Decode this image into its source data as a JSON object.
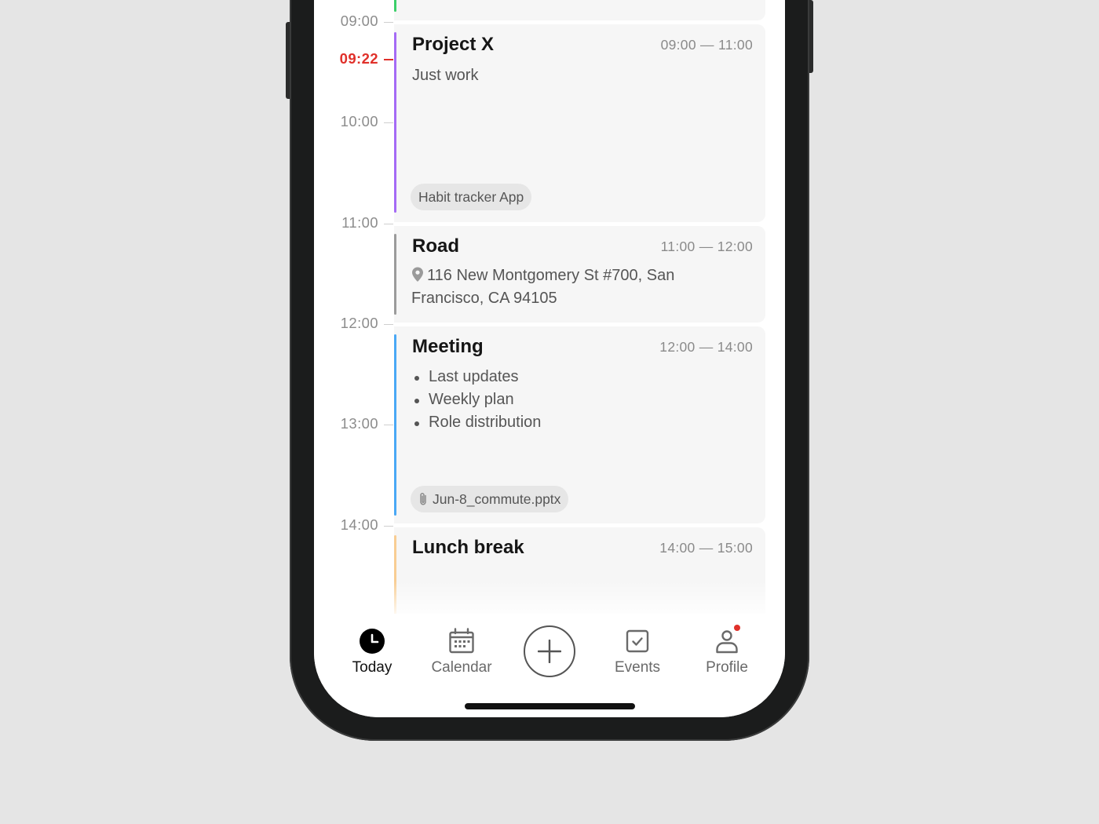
{
  "timeline": {
    "labels": [
      "09:00",
      "10:00",
      "11:00",
      "12:00",
      "13:00",
      "14:00"
    ],
    "current_time": "09:22"
  },
  "events": [
    {
      "title": "Project X",
      "time_range": "09:00 — 11:00",
      "description": "Just work",
      "tag": "Habit tracker App",
      "accent_color": "#a56bf5"
    },
    {
      "title": "Road",
      "time_range": "11:00 — 12:00",
      "address": "116 New Montgomery St #700, San Francisco, CA 94105",
      "accent_color": "#9b9b9b"
    },
    {
      "title": "Meeting",
      "time_range": "12:00 — 14:00",
      "agenda": [
        "Last updates",
        "Weekly plan",
        "Role distribution"
      ],
      "attachment": "Jun-8_commute.pptx",
      "accent_color": "#4aa8f5"
    },
    {
      "title": "Lunch break",
      "time_range": "14:00 — 15:00",
      "accent_color": "#f8cd93"
    }
  ],
  "previous_event_accent": "#3ccf6a",
  "now_color": "#e0302a",
  "tab_bar": {
    "today": "Today",
    "calendar": "Calendar",
    "events": "Events",
    "profile": "Profile",
    "add_icon": "plus-circle-icon",
    "profile_has_notification": true
  }
}
